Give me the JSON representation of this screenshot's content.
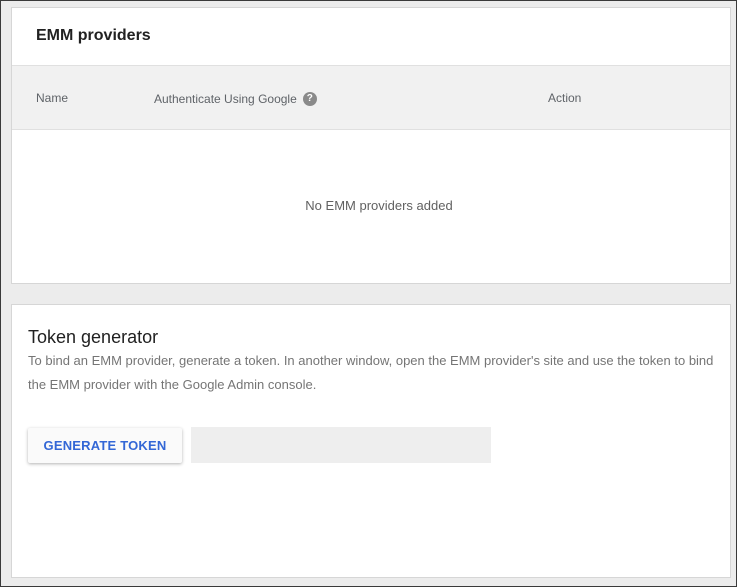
{
  "emm_providers": {
    "title": "EMM providers",
    "columns": {
      "name": "Name",
      "authenticate": "Authenticate Using Google",
      "help_icon": "?",
      "action": "Action"
    },
    "empty_message": "No EMM providers added"
  },
  "token_generator": {
    "title": "Token generator",
    "description": "To bind an EMM provider, generate a token. In another window, open the EMM provider's site and use the token to bind the EMM provider with the Google Admin console.",
    "generate_button_label": "GENERATE TOKEN",
    "token_value": ""
  },
  "colors": {
    "accent": "#3367d6",
    "background": "#ececec",
    "header_row": "#f1f1f1",
    "help_icon": "#8a8a8a"
  }
}
